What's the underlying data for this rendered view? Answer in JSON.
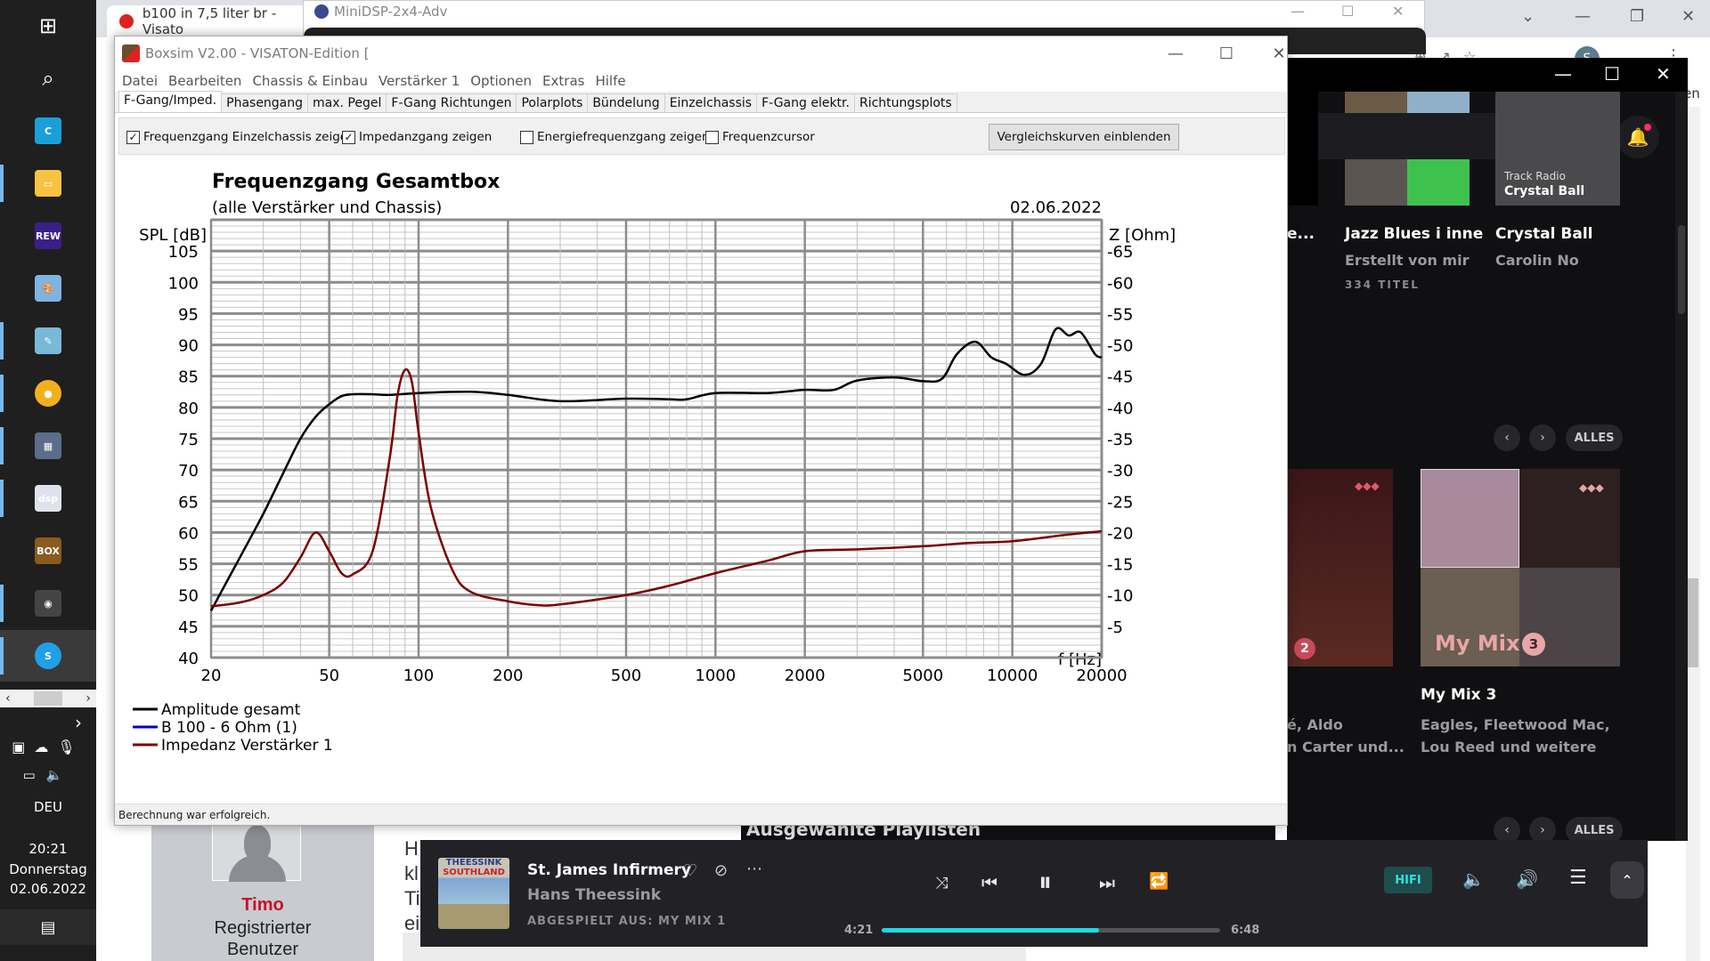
{
  "taskbar": {
    "apps": [
      {
        "name": "start",
        "glyph": "⊞"
      },
      {
        "name": "search",
        "glyph": "⌕"
      },
      {
        "name": "ccleaner",
        "glyph": "C"
      },
      {
        "name": "file-explorer",
        "glyph": "▭"
      },
      {
        "name": "rew",
        "glyph": "REW"
      },
      {
        "name": "paint",
        "glyph": "🎨"
      },
      {
        "name": "notepad",
        "glyph": "✎"
      },
      {
        "name": "chrome",
        "glyph": "●"
      },
      {
        "name": "calculator",
        "glyph": "▦"
      },
      {
        "name": "minidsp",
        "glyph": "dsp"
      },
      {
        "name": "dosbox",
        "glyph": "BOX"
      },
      {
        "name": "boxsim",
        "glyph": "◉"
      },
      {
        "name": "skype",
        "glyph": "S"
      }
    ],
    "language": "DEU",
    "time": "20:21",
    "weekday": "Donnerstag",
    "date": "02.06.2022"
  },
  "chrome": {
    "tab_title": "b100 in 7,5 liter br - Visato",
    "forum_user": "Timo",
    "forum_role_1": "Registrierter",
    "forum_role_2": "Benutzer",
    "post_fragments": [
      "H",
      "kl",
      "Ti",
      "ei"
    ]
  },
  "minidsp": {
    "title": "MiniDSP-2x4-Adv"
  },
  "boxsim": {
    "title": "Boxsim V2.00 - VISATON-Edition [",
    "menu": [
      "Datei",
      "Bearbeiten",
      "Chassis & Einbau",
      "Verstärker 1",
      "Optionen",
      "Extras",
      "Hilfe"
    ],
    "tabs": [
      "F-Gang/Imped.",
      "Phasengang",
      "max. Pegel",
      "F-Gang Richtungen",
      "Polarplots",
      "Bündelung",
      "Einzelchassis",
      "F-Gang elektr.",
      "Richtungsplots"
    ],
    "active_tab": 0,
    "options": [
      {
        "label": "Frequenzgang Einzelchassis zeigen",
        "checked": true
      },
      {
        "label": "Impedanzgang zeigen",
        "checked": true
      },
      {
        "label": "Energiefrequenzgang zeigen",
        "checked": false
      },
      {
        "label": "Frequenzcursor",
        "checked": false
      }
    ],
    "compare_button": "Vergleichskurven einblenden",
    "status": "Berechnung war erfolgreich."
  },
  "chart_data": {
    "type": "line",
    "title": "Frequenzgang Gesamtbox",
    "subtitle": "(alle Verstärker und Chassis)",
    "date": "02.06.2022",
    "xlabel": "f [Hz]",
    "ylabel": "SPL [dB]",
    "y2label": "Z [Ohm]",
    "xscale": "log",
    "xlim": [
      20,
      20000
    ],
    "ylim": [
      40,
      110
    ],
    "y2lim": [
      0,
      70
    ],
    "x_ticks": [
      20,
      50,
      100,
      200,
      500,
      1000,
      2000,
      5000,
      10000,
      20000
    ],
    "y_ticks": [
      40,
      45,
      50,
      55,
      60,
      65,
      70,
      75,
      80,
      85,
      90,
      95,
      100,
      105
    ],
    "y2_ticks": [
      5,
      10,
      15,
      20,
      25,
      30,
      35,
      40,
      45,
      50,
      55,
      60,
      65
    ],
    "grid": true,
    "legend_position": "bottom-left",
    "series": [
      {
        "name": "Amplitude gesamt",
        "color": "#000000",
        "axis": "left",
        "x": [
          20,
          25,
          30,
          35,
          40,
          45,
          50,
          55,
          60,
          70,
          80,
          100,
          150,
          200,
          300,
          500,
          700,
          800,
          1000,
          1500,
          2000,
          2500,
          3000,
          4000,
          5000,
          5800,
          6500,
          7500,
          8500,
          9500,
          11000,
          12500,
          14000,
          15500,
          17000,
          19000,
          20000
        ],
        "values": [
          47.5,
          56,
          63,
          69.5,
          75,
          78.5,
          80.5,
          81.8,
          82.1,
          82.1,
          82,
          82.3,
          82.5,
          82,
          81,
          81.4,
          81.3,
          81.3,
          82.3,
          82.3,
          82.8,
          82.8,
          84.3,
          84.8,
          84.2,
          84.6,
          88.5,
          90.5,
          88,
          87,
          85.2,
          87,
          92.5,
          91.5,
          92,
          88.5,
          88
        ]
      },
      {
        "name": "B 100 - 6 Ohm (1)",
        "color": "#0000cc",
        "axis": "left",
        "x": [],
        "values": []
      },
      {
        "name": "Impedanz Verstärker 1",
        "color": "#7a0000",
        "axis": "right",
        "x": [
          20,
          25,
          30,
          35,
          40,
          45,
          50,
          55,
          60,
          70,
          80,
          85,
          90,
          95,
          100,
          110,
          130,
          150,
          200,
          250,
          300,
          500,
          700,
          1000,
          1500,
          2000,
          3000,
          5000,
          7000,
          10000,
          15000,
          20000
        ],
        "values": [
          8.2,
          8.8,
          10,
          12,
          16,
          20,
          17,
          13.5,
          13.3,
          17,
          32,
          42,
          46,
          44,
          36,
          24,
          14,
          10.5,
          9,
          8.4,
          8.5,
          10,
          11.5,
          13.5,
          15.5,
          17,
          17.3,
          17.8,
          18.3,
          18.6,
          19.6,
          20.2
        ]
      }
    ]
  },
  "tidal": {
    "search_placeholder_fragment": "en",
    "cards_top": [
      {
        "title_fragment": "e...",
        "title": "",
        "subtitle": "",
        "meta": ""
      },
      {
        "title": "Jazz Blues i inne",
        "subtitle": "Erstellt von mir",
        "meta": "334 TITEL"
      },
      {
        "title": "Crystal Ball",
        "subtitle": "Carolin No",
        "overlay_label": "Track Radio",
        "overlay_title": "Crystal Ball"
      }
    ],
    "nav_all": "ALLES",
    "cards_mid": [
      {
        "title": "",
        "subtitle_1": "é, Aldo",
        "subtitle_2": "n Carter und...",
        "badge": "2"
      },
      {
        "title": "My Mix 3",
        "subtitle_1": "Eagles, Fleetwood Mac,",
        "subtitle_2": "Lou Reed und weitere",
        "badge": "3",
        "overlay": "My Mix"
      }
    ],
    "section_heading": "Ausgewählte Playlisten",
    "notification_dot": true
  },
  "player": {
    "album_line_1": "THEESSINK",
    "album_line_2": "SOUTHLAND",
    "track": "St. James Infirmery",
    "artist": "Hans Theessink",
    "source": "ABGESPIELT AUS: MY MIX 1",
    "elapsed": "4:21",
    "duration": "6:48",
    "progress": 0.641,
    "quality": "HIFI",
    "accent": "#20d9e6"
  }
}
